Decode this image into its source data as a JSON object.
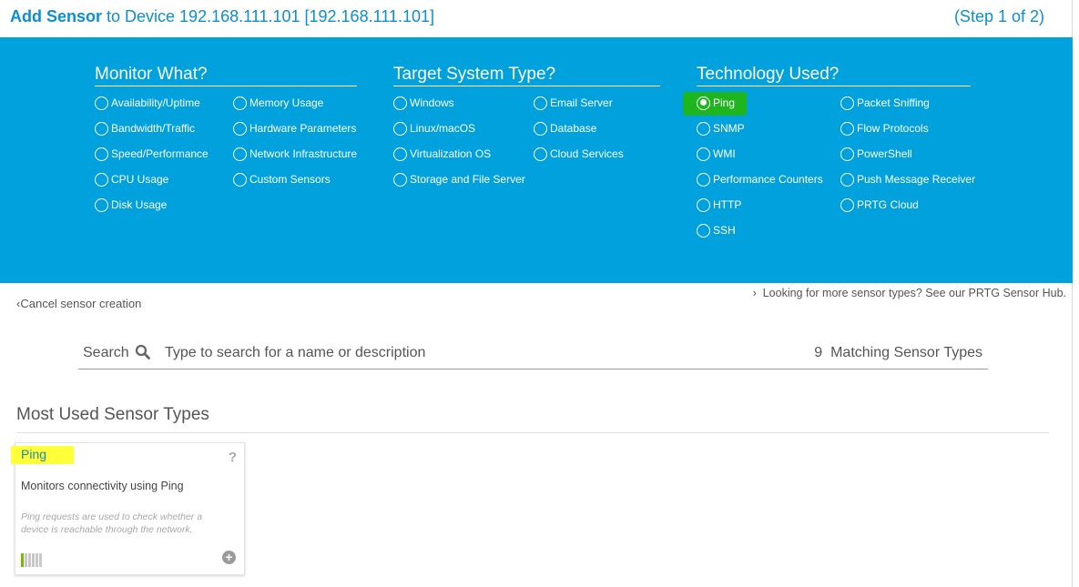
{
  "header": {
    "title_bold": "Add Sensor",
    "title_rest": " to Device 192.168.111.101 [192.168.111.101]",
    "step": "(Step 1 of 2)"
  },
  "filters": {
    "monitor": {
      "heading": "Monitor What?",
      "col1": [
        "Availability/Uptime",
        "Bandwidth/Traffic",
        "Speed/Performance",
        "CPU Usage",
        "Disk Usage"
      ],
      "col2": [
        "Memory Usage",
        "Hardware Parameters",
        "Network Infrastructure",
        "Custom Sensors"
      ]
    },
    "target": {
      "heading": "Target System Type?",
      "col1": [
        "Windows",
        "Linux/macOS",
        "Virtualization OS",
        "Storage and File Server"
      ],
      "col2": [
        "Email Server",
        "Database",
        "Cloud Services"
      ]
    },
    "technology": {
      "heading": "Technology Used?",
      "col1": [
        "Ping",
        "SNMP",
        "WMI",
        "Performance Counters",
        "HTTP",
        "SSH"
      ],
      "col2": [
        "Packet Sniffing",
        "Flow Protocols",
        "PowerShell",
        "Push Message Receiver",
        "PRTG Cloud"
      ],
      "selected": "Ping"
    }
  },
  "links": {
    "cancel": "Cancel sensor creation",
    "hub": "Looking for more sensor types? See our PRTG Sensor Hub."
  },
  "search": {
    "label": "Search",
    "placeholder": "Type to search for a name or description",
    "count": "9",
    "count_label": "Matching Sensor Types"
  },
  "section": {
    "title": "Most Used Sensor Types"
  },
  "card": {
    "name": "Ping",
    "help": "?",
    "description": "Monitors connectivity using Ping",
    "detail": "Ping requests are used to check whether a device is reachable through the network.",
    "performance_impact_level": 1,
    "performance_impact_max": 6
  },
  "colors": {
    "accent": "#0a8fd0",
    "panel": "#00a1dc",
    "highlight_green": "#1fb51f",
    "highlight_yellow": "#ffff3a"
  },
  "icons": {
    "search": "search-icon",
    "chevron": "chevron-left-icon",
    "help": "help-icon",
    "add": "add-circle-icon"
  }
}
